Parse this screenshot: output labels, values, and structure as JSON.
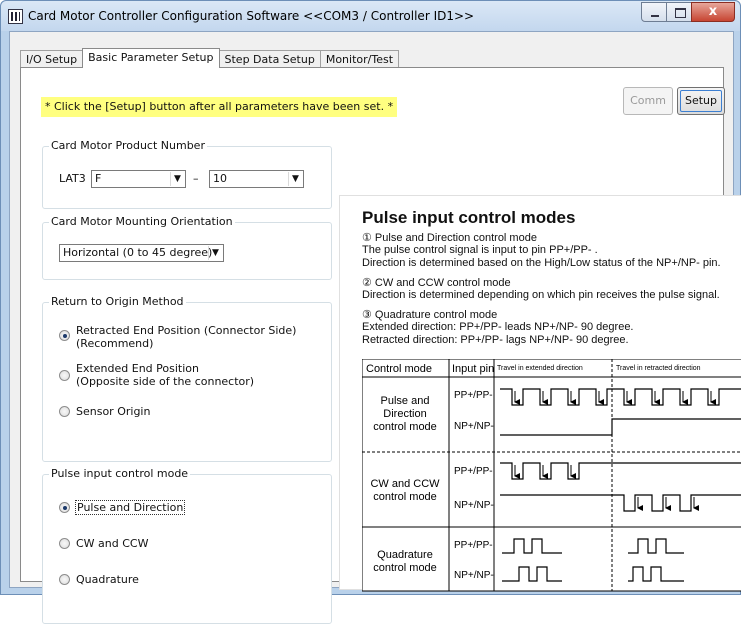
{
  "window": {
    "title": "Card Motor Controller Configuration Software <<COM3 / Controller ID1>>",
    "close_glyph": "x"
  },
  "tabs": [
    {
      "label": "I/O Setup",
      "active": false
    },
    {
      "label": "Basic Parameter Setup",
      "active": true
    },
    {
      "label": "Step Data Setup",
      "active": false
    },
    {
      "label": "Monitor/Test",
      "active": false
    }
  ],
  "notice": "* Click the [Setup] button after all parameters have been set. *",
  "buttons": {
    "comm": "Comm",
    "setup": "Setup"
  },
  "product_number": {
    "title": "Card Motor Product Number",
    "prefix": "LAT3",
    "model": "F",
    "dash": "–",
    "size": "10"
  },
  "mounting": {
    "title": "Card Motor Mounting Orientation",
    "value": "Horizontal (0 to 45 degree)"
  },
  "return_origin": {
    "title": "Return to Origin Method",
    "options": [
      {
        "line1": "Retracted End Position (Connector Side)",
        "line2": "(Recommend)",
        "selected": true
      },
      {
        "line1": "Extended End Position",
        "line2": "(Opposite side of the connector)",
        "selected": false
      },
      {
        "line1": "Sensor Origin",
        "line2": "",
        "selected": false
      }
    ]
  },
  "pulse_mode": {
    "title": "Pulse input control mode",
    "options": [
      {
        "label": "Pulse and Direction",
        "selected": true
      },
      {
        "label": "CW and CCW",
        "selected": false
      },
      {
        "label": "Quadrature",
        "selected": false
      }
    ]
  },
  "diagram": {
    "title": "Pulse input control modes",
    "lines": [
      "① Pulse and Direction control mode",
      "The pulse control signal is input to pin PP+/PP- .",
      "Direction is determined based on the High/Low status of the NP+/NP- pin.",
      "② CW and CCW control mode",
      "Direction is determined depending on which pin receives the pulse signal.",
      "③ Quadrature control mode",
      "Extended direction: PP+/PP- leads NP+/NP- 90 degree.",
      "Retracted direction: PP+/PP- lags NP+/NP- 90 degree."
    ],
    "table": {
      "headers": [
        "Control mode",
        "Input pin",
        "Travel in extended direction",
        "Travel in retracted direction"
      ],
      "rows": [
        {
          "mode": [
            "Pulse and",
            "Direction",
            "control mode"
          ],
          "pins": [
            "PP+/PP-",
            "NP+/NP-"
          ]
        },
        {
          "mode": [
            "CW and CCW",
            "control mode"
          ],
          "pins": [
            "PP+/PP-",
            "NP+/NP-"
          ]
        },
        {
          "mode": [
            "Quadrature",
            "control mode"
          ],
          "pins": [
            "PP+/PP-",
            "NP+/NP-"
          ]
        }
      ]
    }
  }
}
